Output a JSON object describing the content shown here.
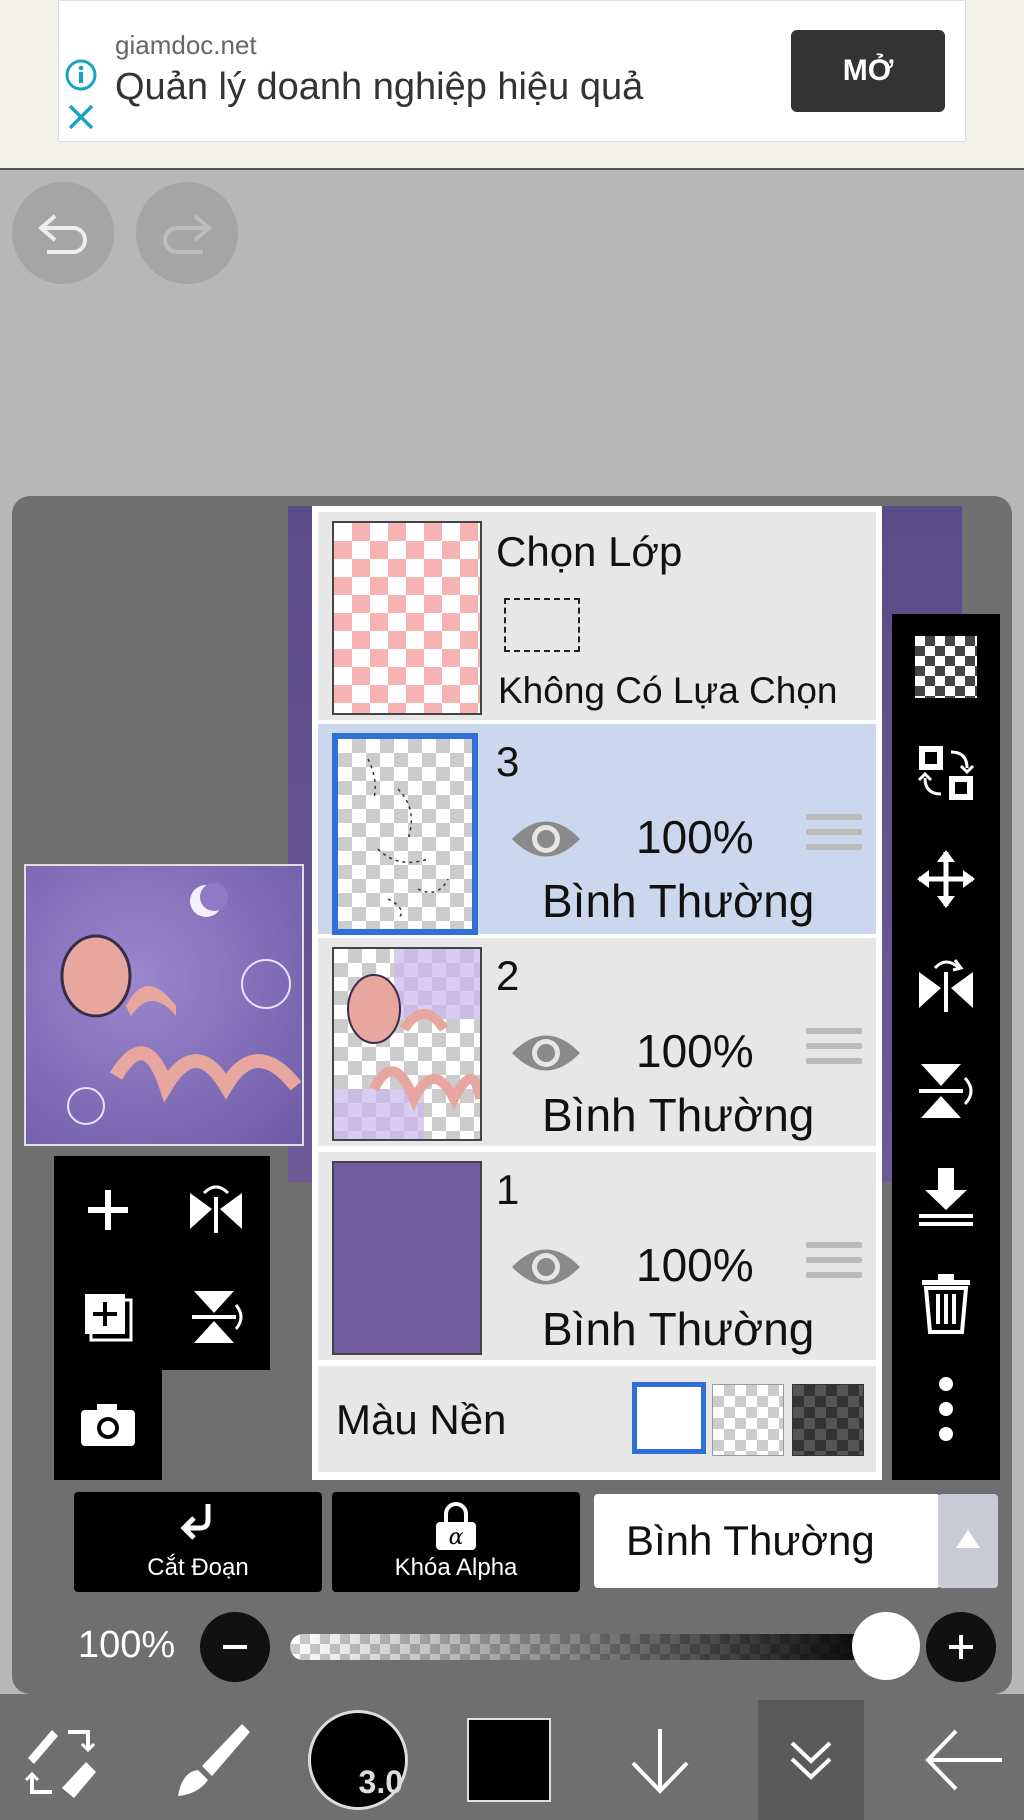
{
  "ad": {
    "domain": "giamdoc.net",
    "headline": "Quản lý doanh nghiệp hiệu quả",
    "open_label": "MỞ"
  },
  "layers_panel": {
    "selection_layer": {
      "title": "Chọn Lớp",
      "status": "Không Có Lựa Chọn"
    },
    "layers": [
      {
        "name": "3",
        "opacity": "100%",
        "mode": "Bình Thường",
        "selected": true
      },
      {
        "name": "2",
        "opacity": "100%",
        "mode": "Bình Thường",
        "selected": false
      },
      {
        "name": "1",
        "opacity": "100%",
        "mode": "Bình Thường",
        "selected": false
      }
    ],
    "background": {
      "label": "Màu Nền"
    }
  },
  "controls": {
    "clipping_label": "Cắt Đoạn",
    "alpha_lock_label": "Khóa Alpha",
    "blend_mode": "Bình Thường",
    "opacity_label": "100%",
    "opacity_value": 1.0
  },
  "toolbar": {
    "brush_size": "3.0"
  },
  "colors": {
    "accent": "#2f6fd6",
    "canvas_purple": "#6c5aa6",
    "layer1_fill": "#715a9e",
    "selected_row": "#cad7ec"
  }
}
